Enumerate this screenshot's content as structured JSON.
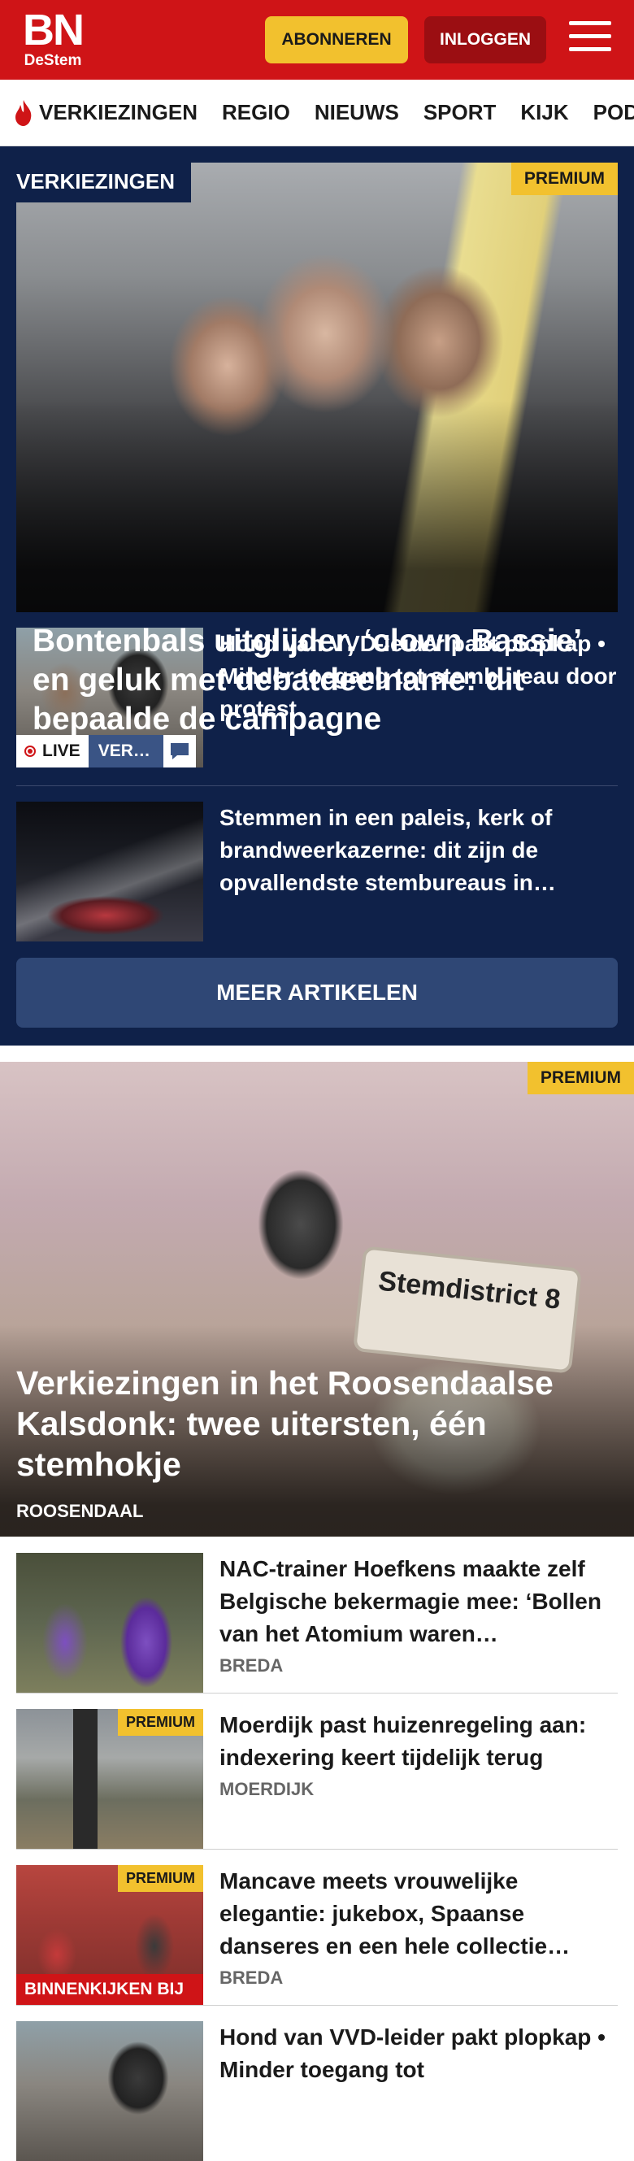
{
  "header": {
    "logo_main": "BN",
    "logo_sub": "DeStem",
    "subscribe_label": "ABONNEREN",
    "login_label": "INLOGGEN",
    "menu_icon": "hamburger-icon"
  },
  "nav": {
    "items": [
      {
        "label": "VERKIEZINGEN",
        "icon": "flame-icon"
      },
      {
        "label": "REGIO"
      },
      {
        "label": "NIEUWS"
      },
      {
        "label": "SPORT"
      },
      {
        "label": "KIJK"
      },
      {
        "label": "PODC"
      }
    ]
  },
  "election": {
    "section_tag": "VERKIEZINGEN",
    "hero": {
      "premium": "PREMIUM",
      "title": "Bontenbals uitglijder, ‘clown Bassie’ en geluk met debatdeelna­me: dit bepaalde de campagne"
    },
    "stories": [
      {
        "title": "Hond van VVD-leider pakt plopkap • Minder toegang tot stembureau door protest",
        "live_label": "LIVE",
        "tag_label": "VER…",
        "chat_icon": "chat-icon"
      },
      {
        "title": "Stemmen in een paleis, kerk of brandweerkazerne: dit zijn de opvallendste stembureaus in…"
      }
    ],
    "more_label": "MEER ARTIKELEN"
  },
  "feature": {
    "premium": "PREMIUM",
    "title": "Verkiezingen in het Roosendaalse Kalsdonk: twee uitersten, één stemhokje",
    "location": "ROOSENDAAL",
    "sign_text": "Stemdistrict 8"
  },
  "list": [
    {
      "title": "NAC-trainer Hoefkens maakte zelf Belgische bekermagie mee: ‘Bollen van het Atomium waren…",
      "location": "BREDA"
    },
    {
      "title": "Moerdijk past huizenregeling aan: indexering keert tijdelijk terug",
      "location": "MOERDIJK",
      "premium": "PREMIUM"
    },
    {
      "title": "Mancave meets vrouwelijke elegantie: jukebox, Spaanse danseres en een hele collectie…",
      "location": "BREDA",
      "premium": "PREMIUM",
      "badge": "BINNENKIJKEN BIJ"
    },
    {
      "title": "Hond van VVD-leider pakt plopkap • Minder toegang tot"
    }
  ],
  "colors": {
    "brand_red": "#cf1417",
    "navy": "#0f2149",
    "premium_yellow": "#f2c12e"
  }
}
